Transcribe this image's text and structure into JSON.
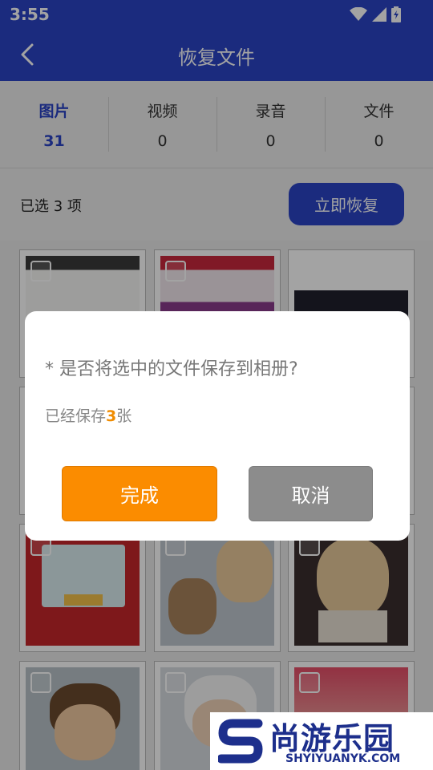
{
  "status": {
    "time": "3:55"
  },
  "header": {
    "title": "恢复文件",
    "back_icon": "chevron-left-icon"
  },
  "tabs": [
    {
      "label": "图片",
      "count": "31",
      "active": true
    },
    {
      "label": "视频",
      "count": "0",
      "active": false
    },
    {
      "label": "录音",
      "count": "0",
      "active": false
    },
    {
      "label": "文件",
      "count": "0",
      "active": false
    }
  ],
  "selection": {
    "text": "已选 3 项",
    "restore_label": "立即恢复"
  },
  "dialog": {
    "question": "* 是否将选中的文件保存到相册?",
    "saved_prefix": "已经保存",
    "saved_count": "3",
    "saved_suffix": "张",
    "done_label": "完成",
    "cancel_label": "取消"
  },
  "watermark": {
    "brand_cn": "尚游乐园",
    "brand_en": "SHYIYUANYK.COM"
  },
  "colors": {
    "primary": "#2b44c6",
    "accent": "#fb8c00",
    "cancel": "#8c8c8c"
  }
}
